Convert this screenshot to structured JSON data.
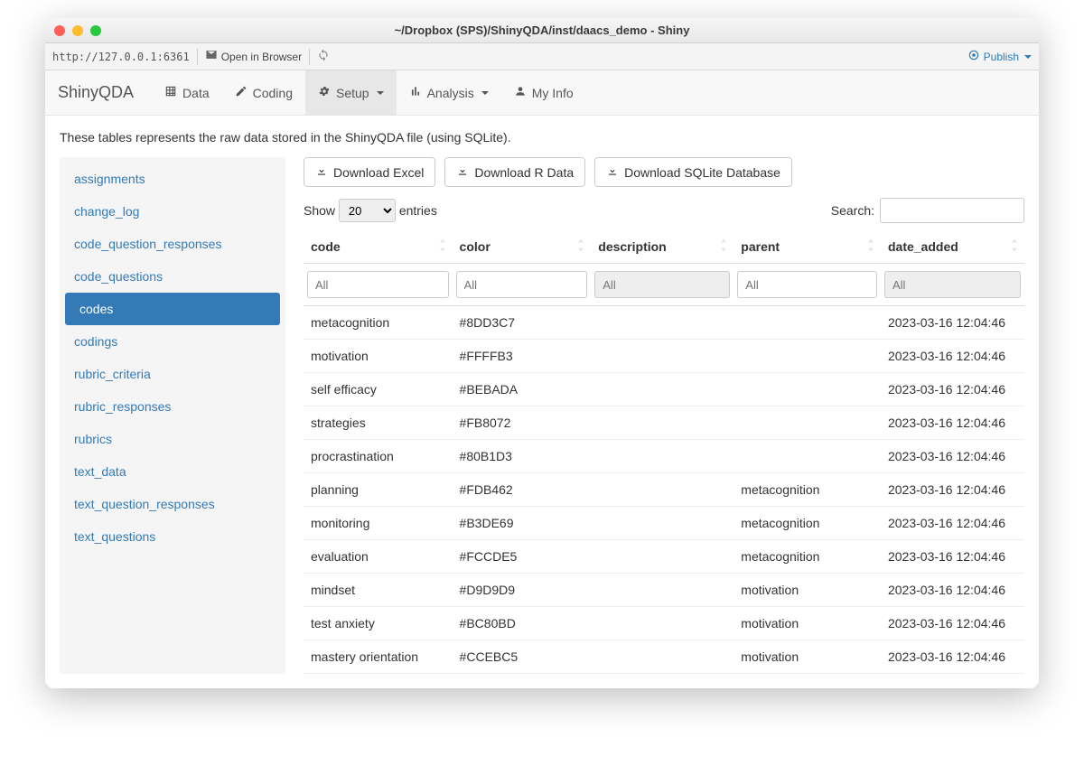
{
  "window": {
    "title": "~/Dropbox (SPS)/ShinyQDA/inst/daacs_demo - Shiny",
    "url": "http://127.0.0.1:6361",
    "open_browser": "Open in Browser",
    "publish": "Publish"
  },
  "nav": {
    "brand": "ShinyQDA",
    "data": "Data",
    "coding": "Coding",
    "setup": "Setup",
    "analysis": "Analysis",
    "myinfo": "My Info"
  },
  "description": "These tables represents the raw data stored in the ShinyQDA file (using SQLite).",
  "sidebar": {
    "items": [
      {
        "label": "assignments"
      },
      {
        "label": "change_log"
      },
      {
        "label": "code_question_responses"
      },
      {
        "label": "code_questions"
      },
      {
        "label": "codes"
      },
      {
        "label": "codings"
      },
      {
        "label": "rubric_criteria"
      },
      {
        "label": "rubric_responses"
      },
      {
        "label": "rubrics"
      },
      {
        "label": "text_data"
      },
      {
        "label": "text_question_responses"
      },
      {
        "label": "text_questions"
      }
    ],
    "active_index": 4
  },
  "buttons": {
    "excel": "Download Excel",
    "rdata": "Download R Data",
    "sqlite": "Download SQLite Database"
  },
  "table": {
    "show_label": "Show",
    "entries_label": "entries",
    "page_size": "20",
    "search_label": "Search:",
    "columns": [
      "code",
      "color",
      "description",
      "parent",
      "date_added"
    ],
    "filter_placeholder": "All",
    "filter_disabled": [
      false,
      false,
      true,
      false,
      true
    ],
    "rows": [
      {
        "code": "metacognition",
        "color": "#8DD3C7",
        "description": "",
        "parent": "",
        "date_added": "2023-03-16 12:04:46"
      },
      {
        "code": "motivation",
        "color": "#FFFFB3",
        "description": "",
        "parent": "",
        "date_added": "2023-03-16 12:04:46"
      },
      {
        "code": "self efficacy",
        "color": "#BEBADA",
        "description": "",
        "parent": "",
        "date_added": "2023-03-16 12:04:46"
      },
      {
        "code": "strategies",
        "color": "#FB8072",
        "description": "",
        "parent": "",
        "date_added": "2023-03-16 12:04:46"
      },
      {
        "code": "procrastination",
        "color": "#80B1D3",
        "description": "",
        "parent": "",
        "date_added": "2023-03-16 12:04:46"
      },
      {
        "code": "planning",
        "color": "#FDB462",
        "description": "",
        "parent": "metacognition",
        "date_added": "2023-03-16 12:04:46"
      },
      {
        "code": "monitoring",
        "color": "#B3DE69",
        "description": "",
        "parent": "metacognition",
        "date_added": "2023-03-16 12:04:46"
      },
      {
        "code": "evaluation",
        "color": "#FCCDE5",
        "description": "",
        "parent": "metacognition",
        "date_added": "2023-03-16 12:04:46"
      },
      {
        "code": "mindset",
        "color": "#D9D9D9",
        "description": "",
        "parent": "motivation",
        "date_added": "2023-03-16 12:04:46"
      },
      {
        "code": "test anxiety",
        "color": "#BC80BD",
        "description": "",
        "parent": "motivation",
        "date_added": "2023-03-16 12:04:46"
      },
      {
        "code": "mastery orientation",
        "color": "#CCEBC5",
        "description": "",
        "parent": "motivation",
        "date_added": "2023-03-16 12:04:46"
      }
    ]
  }
}
